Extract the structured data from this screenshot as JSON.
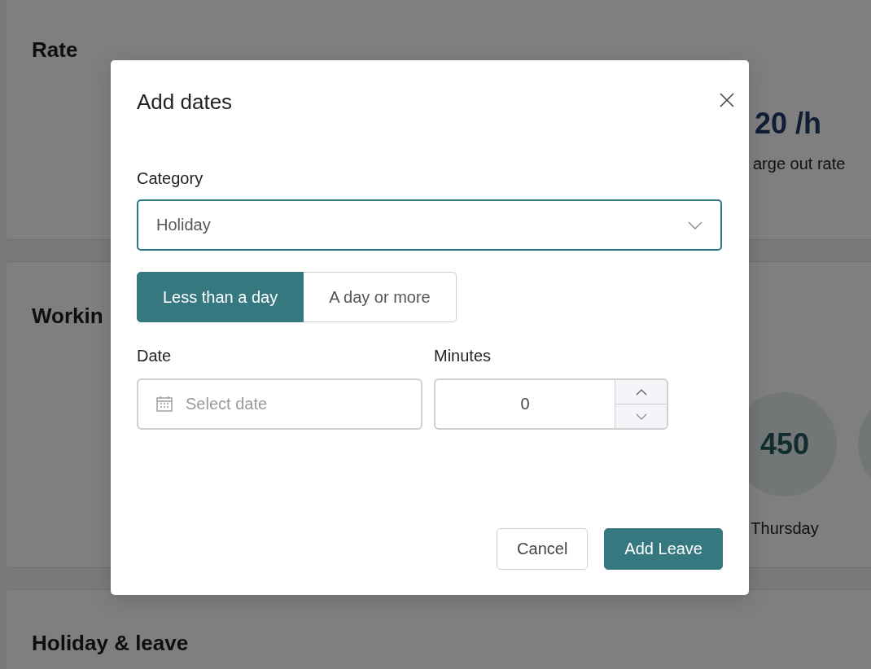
{
  "background": {
    "rate_card": {
      "title": "Rate",
      "amount": "20 /h",
      "caption": "arge out rate"
    },
    "working_card": {
      "title": "Workin",
      "days": [
        {
          "value": "450",
          "label": "Thursday"
        }
      ]
    },
    "holiday_card": {
      "title": "Holiday & leave"
    }
  },
  "dialog": {
    "title": "Add dates",
    "category": {
      "label": "Category",
      "value": "Holiday"
    },
    "duration_options": [
      {
        "label": "Less than a day",
        "selected": true
      },
      {
        "label": "A day or more",
        "selected": false
      }
    ],
    "date": {
      "label": "Date",
      "placeholder": "Select date"
    },
    "minutes": {
      "label": "Minutes",
      "value": "0"
    },
    "buttons": [
      {
        "label": "Cancel",
        "kind": "secondary"
      },
      {
        "label": "Add Leave",
        "kind": "primary"
      }
    ]
  }
}
